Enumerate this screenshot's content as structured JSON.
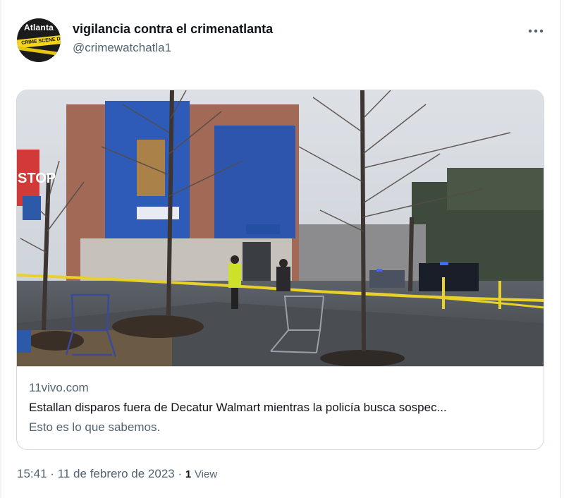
{
  "author": {
    "display_name": "vigilancia contra el crimenatlanta",
    "handle": "@crimewatchatla1",
    "avatar_text": "Atlanta",
    "avatar_tape_text": "CRIME SCENE D"
  },
  "menu": {
    "icon": "more-horizontal-icon"
  },
  "card": {
    "image_sign_text": "STOP",
    "domain": "11vivo.com",
    "title": "Estallan disparos fuera de Decatur Walmart mientras la policía busca sospec...",
    "description": "Esto es lo que sabemos."
  },
  "meta": {
    "time": "15:41",
    "separator": "·",
    "date": "11 de febrero de 2023",
    "views_count": "1",
    "views_label": "View"
  },
  "colors": {
    "primary_text": "#0f1419",
    "secondary_text": "#536471",
    "border": "#cfd9de",
    "police_tape": "#f2d51c"
  }
}
